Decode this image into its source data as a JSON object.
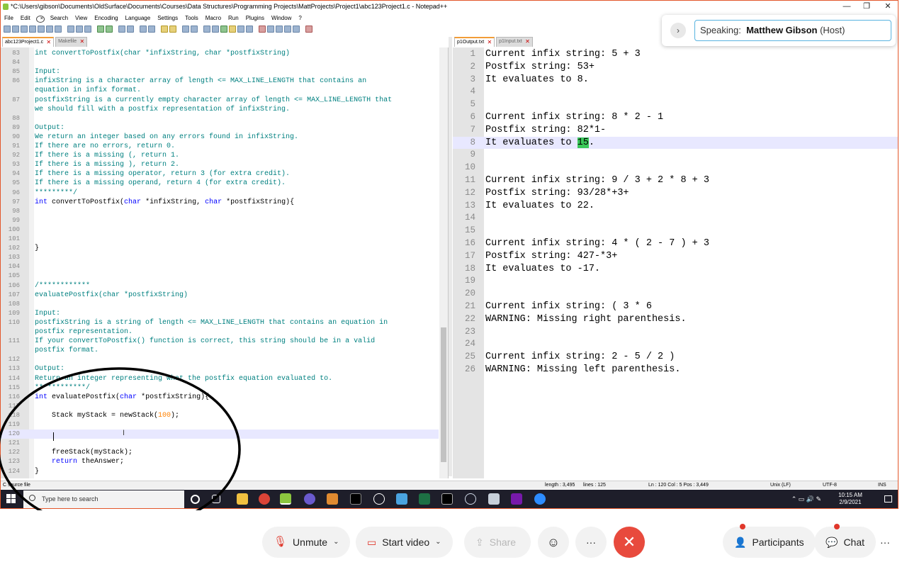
{
  "window": {
    "title": "*C:\\Users\\gibson\\Documents\\OldSurface\\Documents\\Courses\\Data Structures\\Programming Projects\\MattProjects\\Project1\\abc123Project1.c - Notepad++",
    "min": "—",
    "max": "❐",
    "close": "✕"
  },
  "menu": [
    "File",
    "Edit",
    "Search",
    "View",
    "Encoding",
    "Language",
    "Settings",
    "Tools",
    "Macro",
    "Run",
    "Plugins",
    "Window",
    "?"
  ],
  "left_tabs": [
    {
      "label": "abc123Project1.c",
      "active": true
    },
    {
      "label": "Makefile",
      "active": false
    }
  ],
  "right_tabs": [
    {
      "label": "p1Output.txt",
      "active": true
    },
    {
      "label": "p1Input.txt",
      "active": false
    }
  ],
  "code_lines": [
    {
      "n": "83",
      "t": "int convertToPostfix(char *infixString, char *postfixString)"
    },
    {
      "n": "84",
      "t": ""
    },
    {
      "n": "85",
      "t": "Input:"
    },
    {
      "n": "86",
      "t": "infixString is a character array of length <= MAX_LINE_LENGTH that contains an"
    },
    {
      "n": "",
      "t": "equation in infix format."
    },
    {
      "n": "87",
      "t": "postfixString is a currently empty character array of length <= MAX_LINE_LENGTH that"
    },
    {
      "n": "",
      "t": "we should fill with a postfix representation of infixString."
    },
    {
      "n": "88",
      "t": ""
    },
    {
      "n": "89",
      "t": "Output:"
    },
    {
      "n": "90",
      "t": "We return an integer based on any errors found in infixString."
    },
    {
      "n": "91",
      "t": "If there are no errors, return 0."
    },
    {
      "n": "92",
      "t": "If there is a missing (, return 1."
    },
    {
      "n": "93",
      "t": "If there is a missing ), return 2."
    },
    {
      "n": "94",
      "t": "If there is a missing operator, return 3 (for extra credit)."
    },
    {
      "n": "95",
      "t": "If there is a missing operand, return 4 (for extra credit)."
    },
    {
      "n": "96",
      "t": "*********/"
    },
    {
      "n": "97",
      "t": "int convertToPostfix(char *infixString, char *postfixString){",
      "code": true
    },
    {
      "n": "98",
      "t": ""
    },
    {
      "n": "99",
      "t": ""
    },
    {
      "n": "100",
      "t": ""
    },
    {
      "n": "101",
      "t": ""
    },
    {
      "n": "102",
      "t": "}",
      "code": true
    },
    {
      "n": "103",
      "t": ""
    },
    {
      "n": "104",
      "t": ""
    },
    {
      "n": "105",
      "t": ""
    },
    {
      "n": "106",
      "t": "/************"
    },
    {
      "n": "107",
      "t": "evaluatePostfix(char *postfixString)"
    },
    {
      "n": "108",
      "t": ""
    },
    {
      "n": "109",
      "t": "Input:"
    },
    {
      "n": "110",
      "t": "postfixString is a string of length <= MAX_LINE_LENGTH that contains an equation in"
    },
    {
      "n": "",
      "t": "postfix representation."
    },
    {
      "n": "111",
      "t": "If your convertToPostfix() function is correct, this string should be in a valid"
    },
    {
      "n": "",
      "t": "postfix format."
    },
    {
      "n": "112",
      "t": ""
    },
    {
      "n": "113",
      "t": "Output:"
    },
    {
      "n": "114",
      "t": "Return an integer representing what the postfix equation evaluated to."
    },
    {
      "n": "115",
      "t": "************/"
    },
    {
      "n": "116",
      "t": "int evaluatePostfix(char *postfixString){",
      "code": true
    },
    {
      "n": "117",
      "t": ""
    },
    {
      "n": "118",
      "t": "    Stack myStack = newStack(100);",
      "code": true
    },
    {
      "n": "119",
      "t": ""
    },
    {
      "n": "120",
      "t": "",
      "current": true
    },
    {
      "n": "121",
      "t": ""
    },
    {
      "n": "122",
      "t": "    freeStack(myStack);",
      "code": true
    },
    {
      "n": "123",
      "t": "    return theAnswer;",
      "code": true
    },
    {
      "n": "124",
      "t": "}",
      "code": true
    }
  ],
  "output_lines": [
    {
      "n": "1",
      "t": "Current infix string: 5 + 3"
    },
    {
      "n": "2",
      "t": "Postfix string: 53+"
    },
    {
      "n": "3",
      "t": "It evaluates to 8."
    },
    {
      "n": "4",
      "t": ""
    },
    {
      "n": "5",
      "t": ""
    },
    {
      "n": "6",
      "t": "Current infix string: 8 * 2 - 1"
    },
    {
      "n": "7",
      "t": "Postfix string: 82*1-"
    },
    {
      "n": "8",
      "t": "It evaluates to ",
      "highlight": "15",
      "after": ".",
      "current": true
    },
    {
      "n": "9",
      "t": ""
    },
    {
      "n": "10",
      "t": ""
    },
    {
      "n": "11",
      "t": "Current infix string: 9 / 3 + 2 * 8 + 3"
    },
    {
      "n": "12",
      "t": "Postfix string: 93/28*+3+"
    },
    {
      "n": "13",
      "t": "It evaluates to 22."
    },
    {
      "n": "14",
      "t": ""
    },
    {
      "n": "15",
      "t": ""
    },
    {
      "n": "16",
      "t": "Current infix string: 4 * ( 2 - 7 ) + 3"
    },
    {
      "n": "17",
      "t": "Postfix string: 427-*3+"
    },
    {
      "n": "18",
      "t": "It evaluates to -17."
    },
    {
      "n": "19",
      "t": ""
    },
    {
      "n": "20",
      "t": ""
    },
    {
      "n": "21",
      "t": "Current infix string: ( 3 * 6"
    },
    {
      "n": "22",
      "t": "WARNING: Missing right parenthesis."
    },
    {
      "n": "23",
      "t": ""
    },
    {
      "n": "24",
      "t": ""
    },
    {
      "n": "25",
      "t": "Current infix string: 2 - 5 / 2 )"
    },
    {
      "n": "26",
      "t": "WARNING: Missing left parenthesis."
    }
  ],
  "status": {
    "filetype": "C source file",
    "length": "length : 3,495",
    "lines": "lines : 125",
    "position": "Ln : 120   Col : 5   Pos : 3,449",
    "eol": "Unix (LF)",
    "encoding": "UTF-8",
    "mode": "INS"
  },
  "taskbar": {
    "search_placeholder": "Type here to search",
    "time": "10:15 AM",
    "date": "2/9/2021",
    "tray_icons": "⌃ ▭ 🔊 ✎"
  },
  "speaking": {
    "label": "Speaking:",
    "name": "Matthew Gibson",
    "role": "(Host)"
  },
  "zoom": {
    "unmute": "Unmute",
    "start_video": "Start video",
    "share": "Share",
    "participants": "Participants",
    "chat": "Chat",
    "more": "···",
    "leave": "✕",
    "reactions": "☺"
  },
  "colors": {
    "window_border": "#e3572b",
    "comment": "#008080",
    "highlight": "#3ac85a",
    "leave": "#e84a3d",
    "speaking_border": "#58b3e0"
  }
}
